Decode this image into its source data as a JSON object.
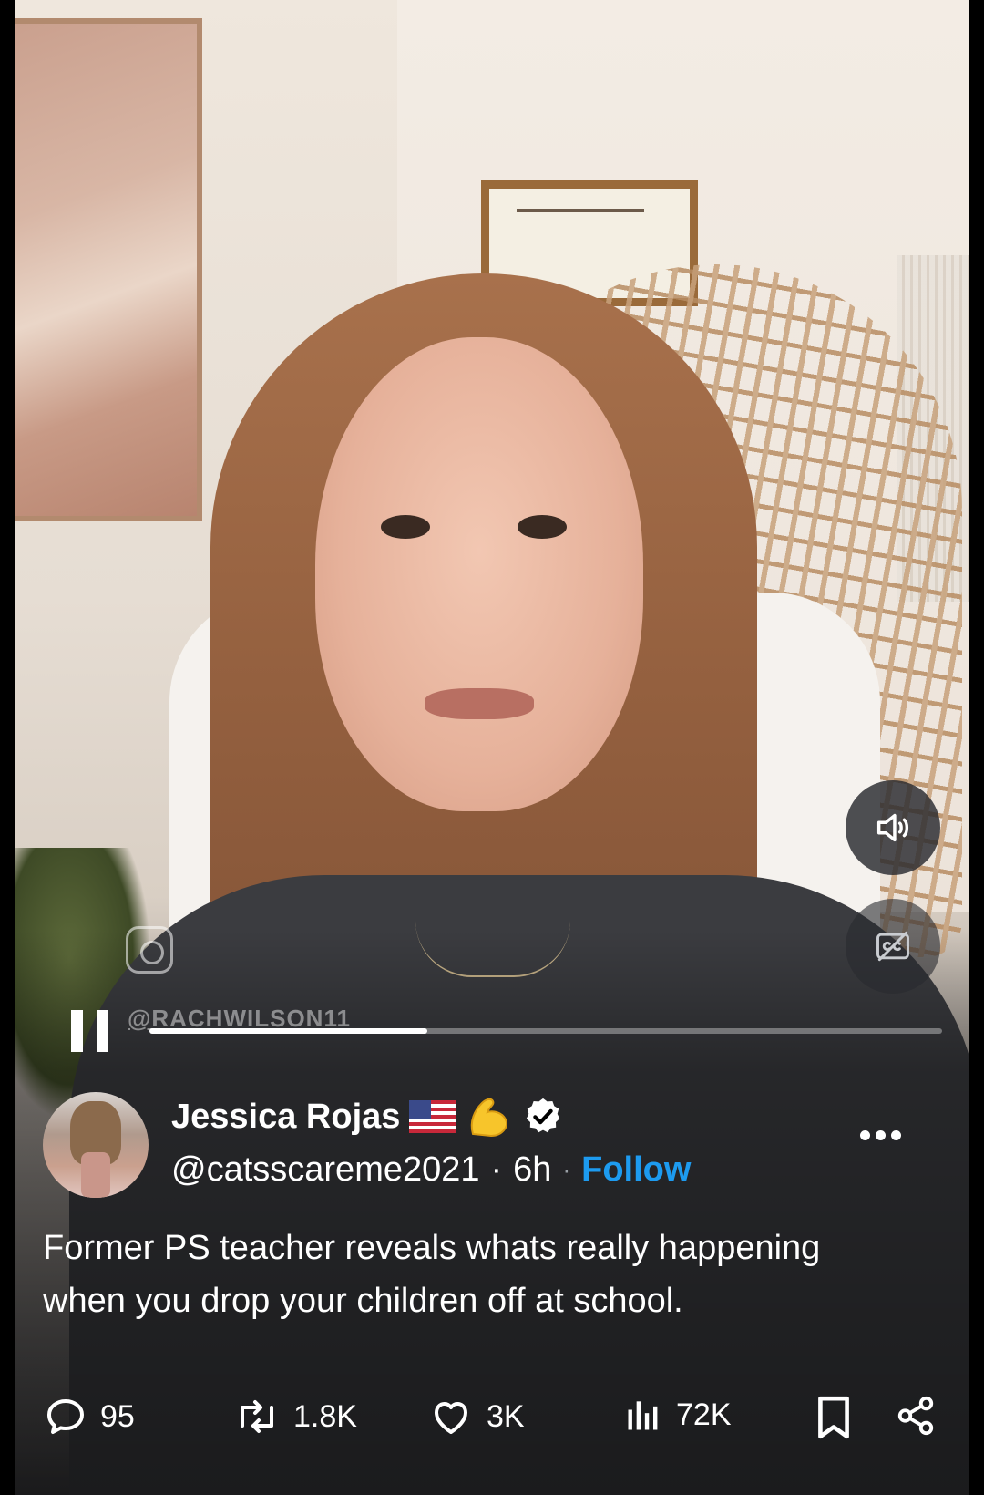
{
  "video": {
    "watermark_handle": "@RACHWILSON11",
    "progress": 0.35
  },
  "author": {
    "name": "Jessica Rojas",
    "badges": [
      "flag-usa-icon",
      "flexed-biceps-icon",
      "verified-icon"
    ],
    "handle": "@catsscareme2021",
    "separator": "·",
    "age": "6h",
    "follow_label": "Follow",
    "accent_color": "#1d9bf0"
  },
  "post": {
    "text_line1": "Former PS teacher reveals whats really happening",
    "text_line2": "when you drop your children off at school."
  },
  "actions": {
    "replies": "95",
    "reposts": "1.8K",
    "likes": "3K",
    "views": "72K"
  }
}
